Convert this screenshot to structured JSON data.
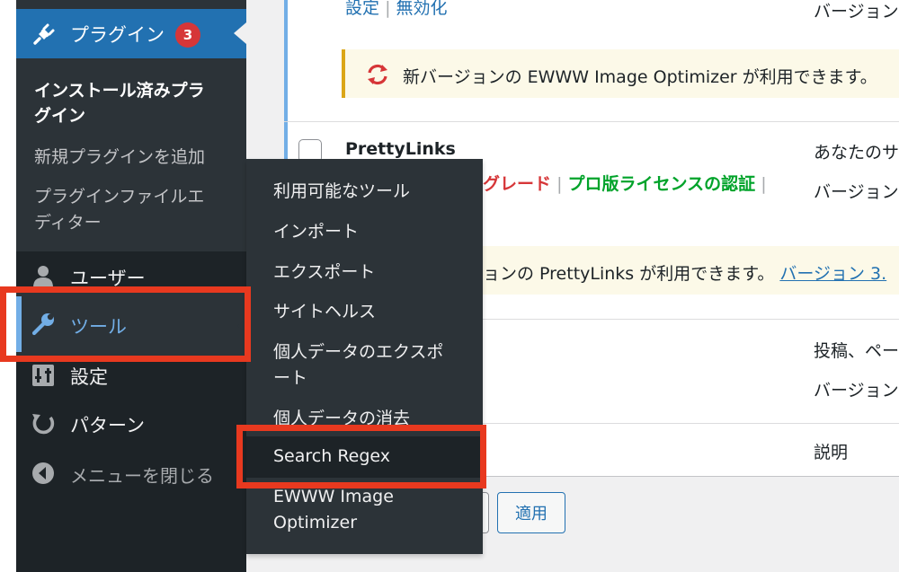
{
  "main": {
    "row1": {
      "actions": [
        "設定",
        "無効化"
      ],
      "desc_partial": "バージョン",
      "update_notice": "新バージョンの EWWW Image Optimizer が利用できます。"
    },
    "row2": {
      "plugin_name": "PrettyLinks",
      "actions_visible": [
        "グレード",
        "プロ版ライセンスの認証"
      ],
      "desc_partial": "あなたのサ",
      "version_partial": "バージョン",
      "update_notice_partial": "ョンの PrettyLinks が利用できます。",
      "update_link_partial": "バージョン 3."
    },
    "row3": {
      "desc_partial": "投稿、ペー",
      "version_partial": "バージョン"
    },
    "footer_header": "説明",
    "apply_button": "適用"
  },
  "sidebar": {
    "plugins": {
      "label": "プラグイン",
      "badge": "3"
    },
    "plugins_sub": [
      {
        "label": "インストール済みプラグイン"
      },
      {
        "label": "新規プラグインを追加"
      },
      {
        "label": "プラグインファイルエディター"
      }
    ],
    "items": [
      {
        "label": "ユーザー"
      },
      {
        "label": "ツール"
      },
      {
        "label": "設定"
      },
      {
        "label": "パターン"
      },
      {
        "label": "メニューを閉じる"
      }
    ]
  },
  "flyout": {
    "items": [
      {
        "label": "利用可能なツール"
      },
      {
        "label": "インポート"
      },
      {
        "label": "エクスポート"
      },
      {
        "label": "サイトヘルス"
      },
      {
        "label": "個人データのエクスポート"
      },
      {
        "label": "個人データの消去"
      },
      {
        "label": "Search Regex"
      },
      {
        "label": "EWWW Image Optimizer"
      }
    ]
  },
  "colors": {
    "sidebar_bg": "#1d2327",
    "accent_blue": "#2271b1",
    "highlight_red": "#e8391f"
  }
}
